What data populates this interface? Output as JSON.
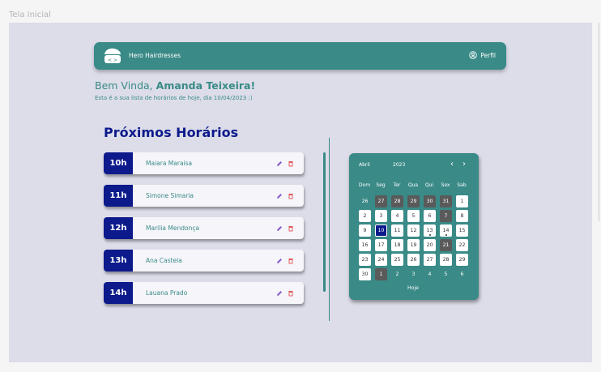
{
  "frame": {
    "label": "Tela Inicial"
  },
  "header": {
    "brand": "Hero Hairdresses",
    "profile_label": "Perfil"
  },
  "welcome": {
    "greeting": "Bem Vinda,",
    "user_name": "Amanda Teixeira!",
    "subtitle": "Esta é a sua lista de horários de hoje, dia  10/04/2023 :)"
  },
  "schedule": {
    "title": "Próximos Horários",
    "items": [
      {
        "hour": "10h",
        "client": "Maiara Maraisa"
      },
      {
        "hour": "11h",
        "client": "Simone Simaria"
      },
      {
        "hour": "12h",
        "client": "Marilia Mendonça"
      },
      {
        "hour": "13h",
        "client": "Ana Castela"
      },
      {
        "hour": "14h",
        "client": "Lauana Prado"
      }
    ]
  },
  "calendar": {
    "month": "Abril",
    "year": "2023",
    "prev_icon": "‹",
    "next_icon": "›",
    "weekdays": [
      "Dom",
      "Seg",
      "Ter",
      "Qua",
      "Qui",
      "Sex",
      "Sab"
    ],
    "days": [
      [
        "26",
        "27",
        "28",
        "29",
        "30",
        "31",
        "1"
      ],
      [
        "2",
        "3",
        "4",
        "5",
        "6",
        "7",
        "8"
      ],
      [
        "9",
        "10",
        "11",
        "12",
        "13",
        "14",
        "15"
      ],
      [
        "16",
        "17",
        "18",
        "19",
        "20",
        "21",
        "22"
      ],
      [
        "23",
        "24",
        "25",
        "26",
        "27",
        "28",
        "29"
      ],
      [
        "30",
        "1",
        "2",
        "3",
        "4",
        "5",
        "6"
      ]
    ],
    "today_label": "Hoje"
  },
  "colors": {
    "primary": "#3a8a87",
    "accent": "#0d1a8c",
    "background": "#dcdde9"
  }
}
